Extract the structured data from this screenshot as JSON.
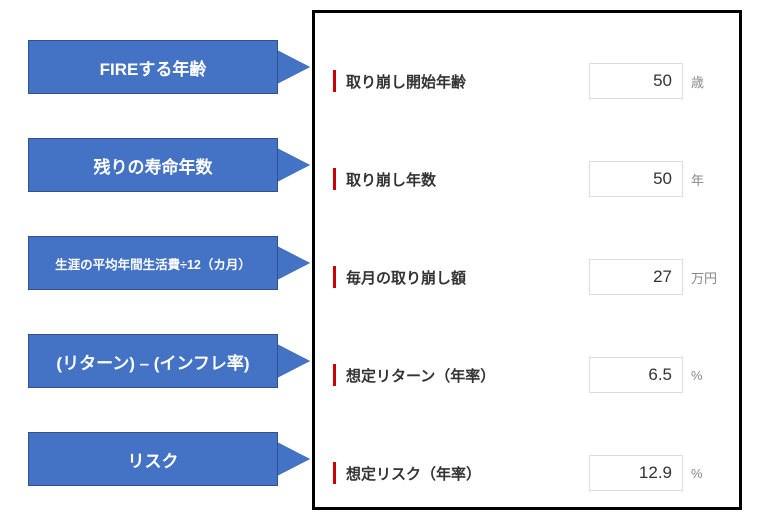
{
  "callouts": [
    {
      "text": "FIREする年齢"
    },
    {
      "text": "残りの寿命年数"
    },
    {
      "text": "生涯の平均年間生活費÷12（カ月）"
    },
    {
      "text": "(リターン) – (インフレ率)"
    },
    {
      "text": "リスク"
    }
  ],
  "fields": [
    {
      "label": "取り崩し開始年齢",
      "value": "50",
      "unit": "歳"
    },
    {
      "label": "取り崩し年数",
      "value": "50",
      "unit": "年"
    },
    {
      "label": "毎月の取り崩し額",
      "value": "27",
      "unit": "万円"
    },
    {
      "label": "想定リターン（年率）",
      "value": "6.5",
      "unit": "%"
    },
    {
      "label": "想定リスク（年率）",
      "value": "12.9",
      "unit": "%"
    }
  ]
}
